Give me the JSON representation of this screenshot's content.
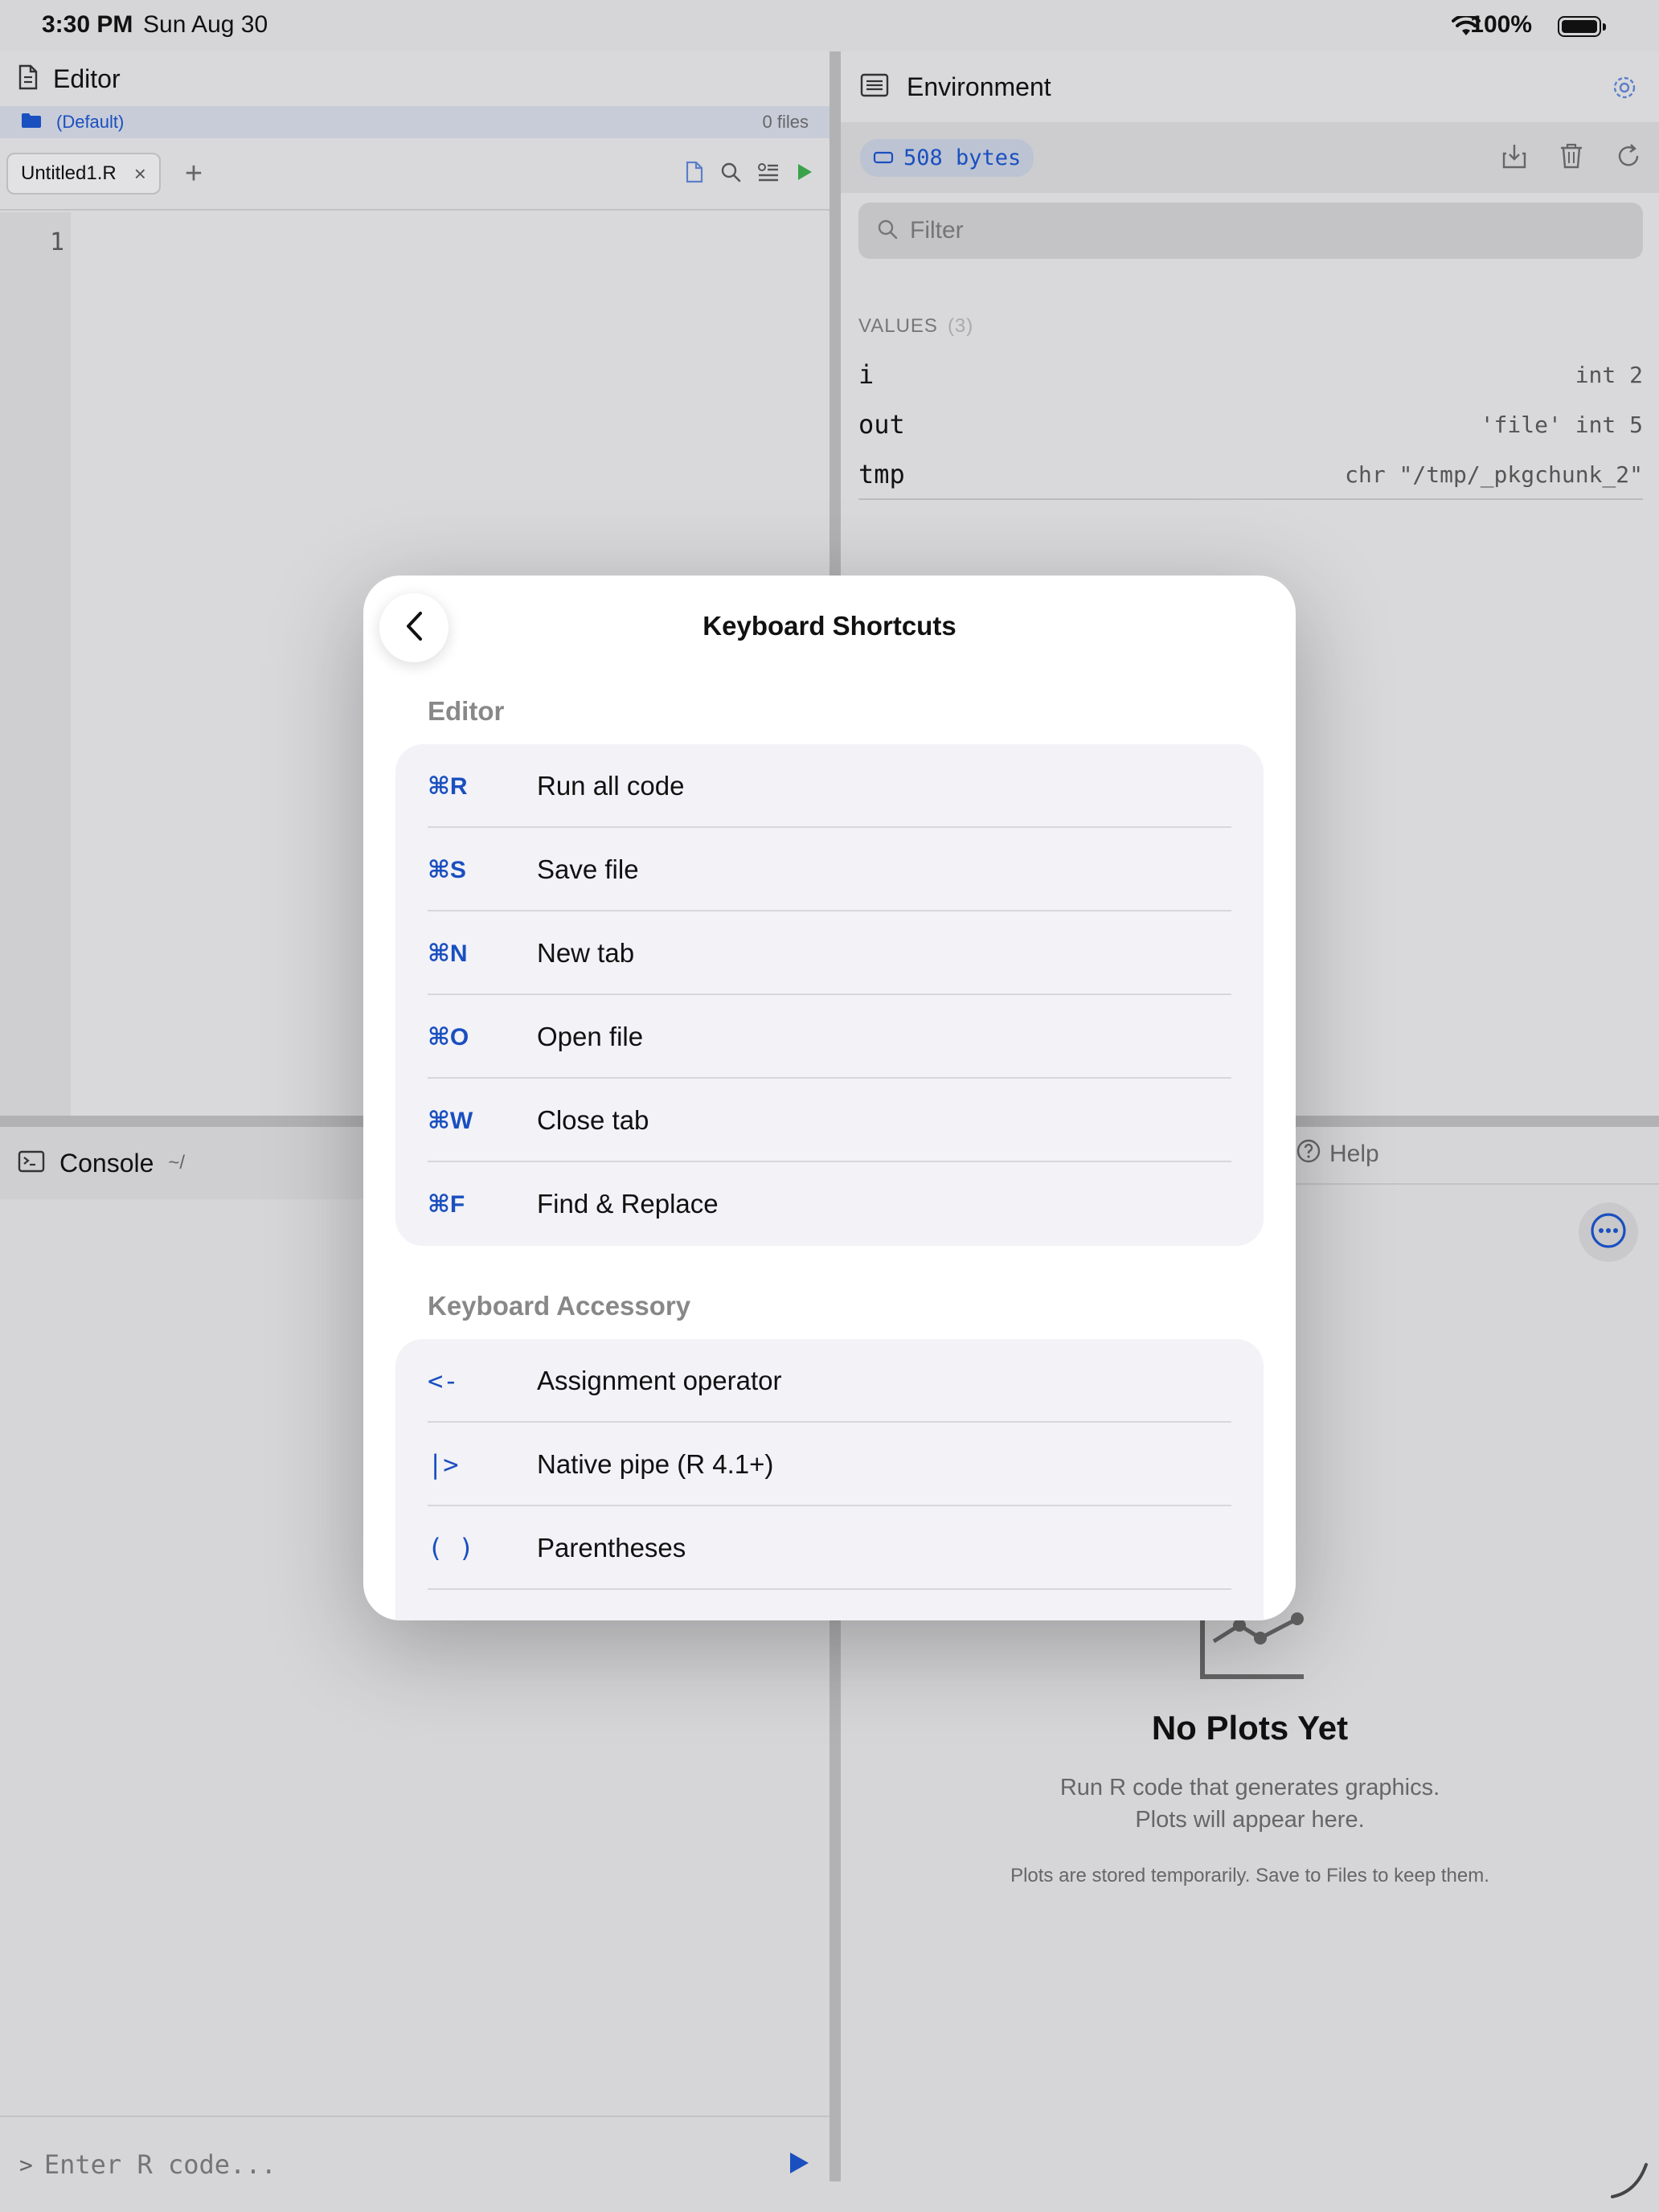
{
  "status_bar": {
    "time": "3:30 PM",
    "date": "Sun Aug 30",
    "battery": "100%"
  },
  "editor": {
    "title": "Editor",
    "project": {
      "name": "(Default)",
      "file_count": "0 files"
    },
    "tabs": [
      {
        "label": "Untitled1.R",
        "close": "×"
      }
    ],
    "add_tab": "+",
    "line_numbers": [
      "1"
    ]
  },
  "console": {
    "title": "Console",
    "path": "~/",
    "prompt": ">",
    "input_placeholder": "Enter R code..."
  },
  "environment": {
    "title": "Environment",
    "memory": "508 bytes",
    "filter_placeholder": "Filter",
    "values_header": "VALUES",
    "values_count": "(3)",
    "values": [
      {
        "name": "i",
        "value": "int 2"
      },
      {
        "name": "out",
        "value": "'file' int 5"
      },
      {
        "name": "tmp",
        "value": "chr \"/tmp/_pkgchunk_2\""
      }
    ]
  },
  "plots": {
    "help_tab": "Help",
    "empty_title": "No Plots Yet",
    "empty_line1": "Run R code that generates graphics.",
    "empty_line2": "Plots will appear here.",
    "empty_note": "Plots are stored temporarily. Save to Files to keep them."
  },
  "modal": {
    "title": "Keyboard Shortcuts",
    "sections": [
      {
        "title": "Editor",
        "items": [
          {
            "key": "⌘R",
            "label": "Run all code"
          },
          {
            "key": "⌘S",
            "label": "Save file"
          },
          {
            "key": "⌘N",
            "label": "New tab"
          },
          {
            "key": "⌘O",
            "label": "Open file"
          },
          {
            "key": "⌘W",
            "label": "Close tab"
          },
          {
            "key": "⌘F",
            "label": "Find & Replace"
          }
        ]
      },
      {
        "title": "Keyboard Accessory",
        "items": [
          {
            "key": "<-",
            "label": "Assignment operator"
          },
          {
            "key": "|>",
            "label": "Native pipe (R 4.1+)"
          },
          {
            "key": "( )",
            "label": "Parentheses"
          }
        ]
      }
    ]
  },
  "colors": {
    "accent": "#1a4fbf",
    "run_green": "#3aa24a",
    "modal_group_bg": "#f2f2f7"
  }
}
